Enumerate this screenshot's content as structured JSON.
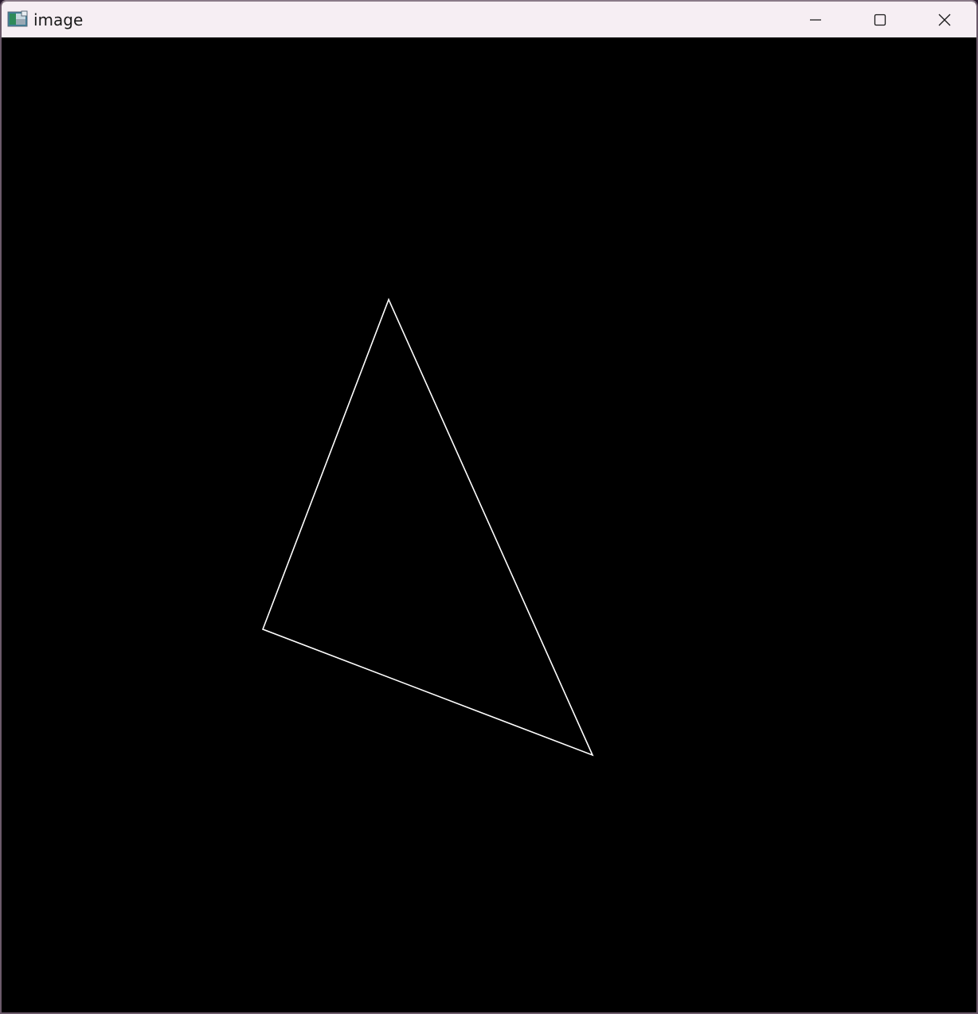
{
  "window": {
    "title": "image",
    "app_icon": "image-viewer-icon",
    "controls": {
      "minimize_icon": "minimize-icon",
      "maximize_icon": "maximize-icon",
      "close_icon": "close-icon"
    }
  },
  "canvas": {
    "background": "#000000",
    "shape": {
      "type": "triangle",
      "stroke": "#ffffff",
      "fill": "none"
    }
  }
}
